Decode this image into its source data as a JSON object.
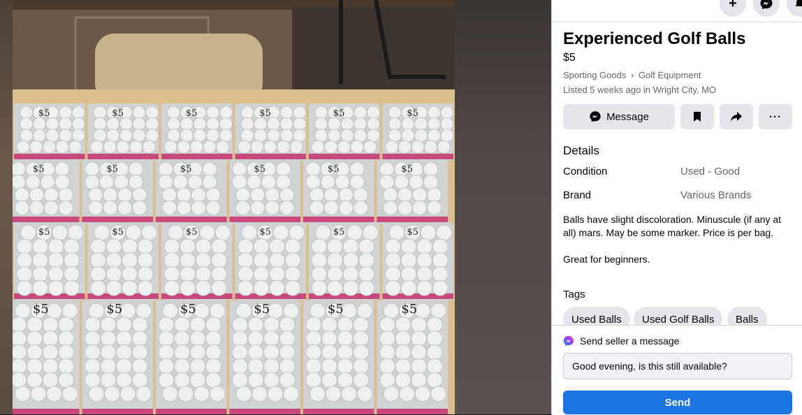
{
  "listing": {
    "title": "Experienced Golf Balls",
    "price": "$5",
    "category": "Sporting Goods",
    "subcategory": "Golf Equipment",
    "breadcrumb_separator": "›",
    "listed": "Listed 5 weeks ago in Wright City, MO"
  },
  "actions": {
    "message_label": "Message",
    "save_icon": "bookmark-icon",
    "share_icon": "share-icon",
    "more_label": "···"
  },
  "top_bar": {
    "icons": [
      "plus-icon",
      "messenger-icon",
      "notifications-icon"
    ],
    "plus_label": "+"
  },
  "details": {
    "heading": "Details",
    "rows": [
      {
        "key": "Condition",
        "value": "Used - Good"
      },
      {
        "key": "Brand",
        "value": "Various Brands"
      }
    ],
    "description": [
      "Balls have slight discoloration. Minuscule (if any at all) mars. May be some marker. Price is per bag.",
      "Great for beginners."
    ]
  },
  "tags": {
    "heading": "Tags",
    "items": [
      "Used Balls",
      "Used Golf Balls",
      "Balls"
    ]
  },
  "message_box": {
    "label": "Send seller a message",
    "input_value": "Good evening, is this still available?",
    "send_label": "Send"
  },
  "photo": {
    "bag_label": "$5"
  },
  "colors": {
    "accent": "#1b74e4",
    "button_gray": "#e4e6eb",
    "text_secondary": "#65676b"
  }
}
